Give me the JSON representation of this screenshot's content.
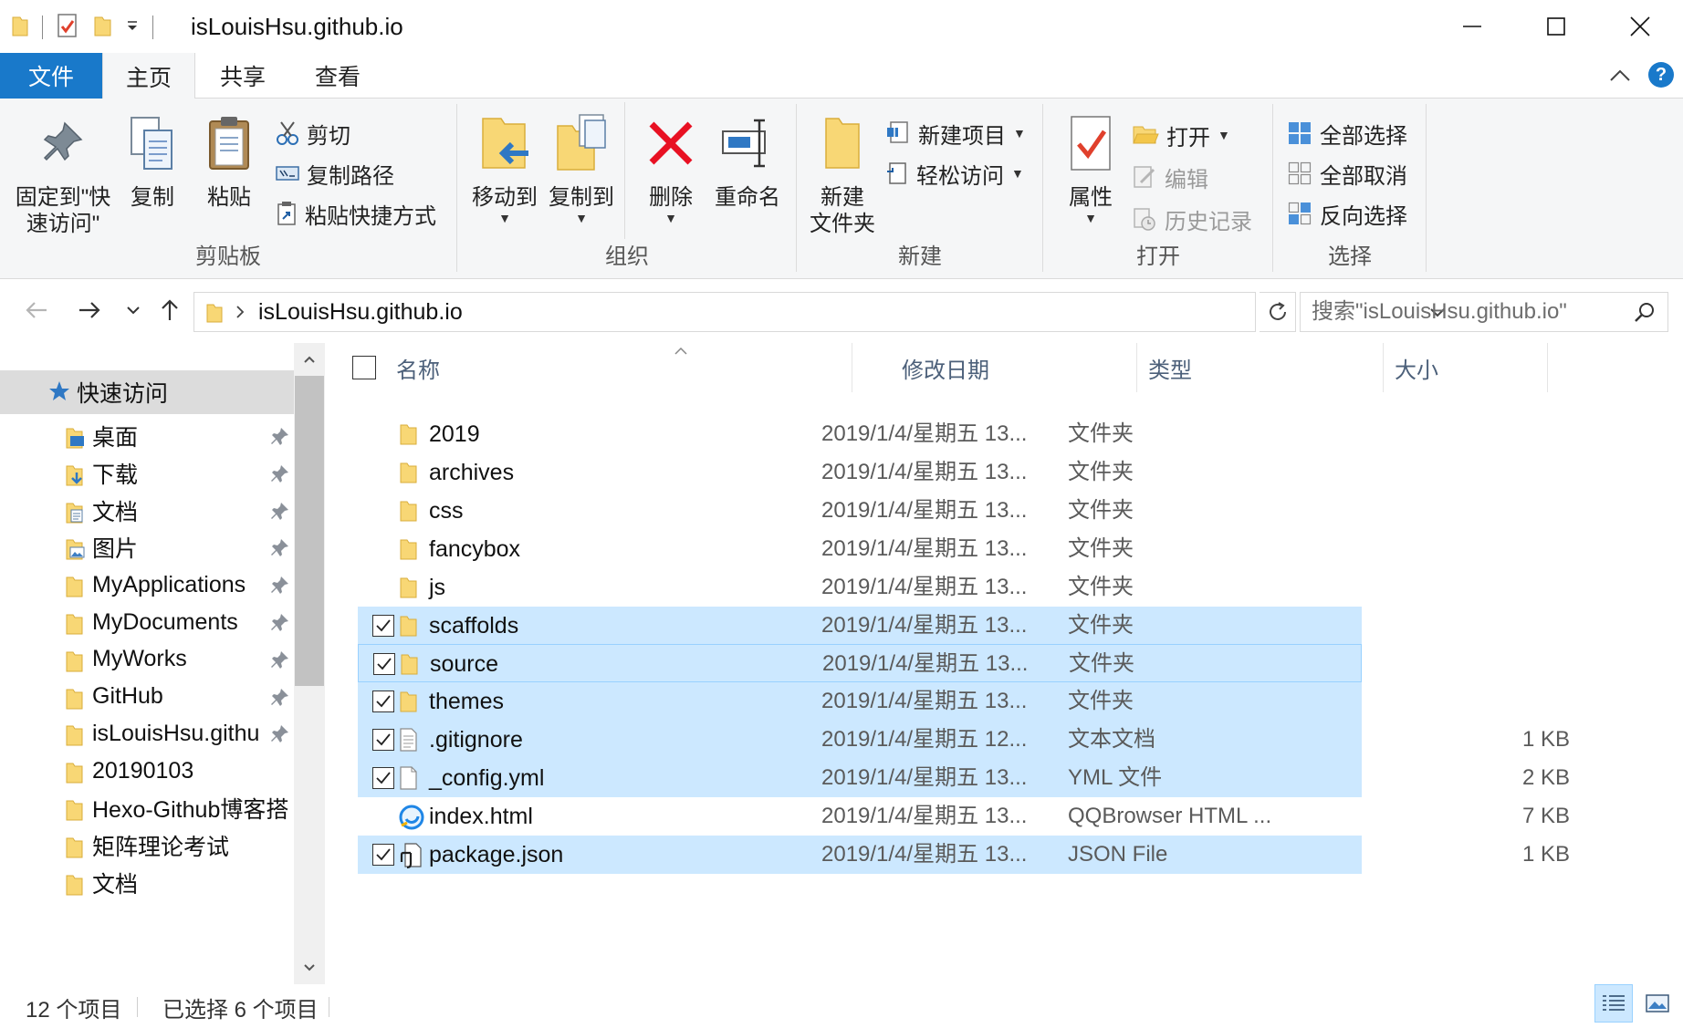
{
  "window": {
    "title": "isLouisHsu.github.io"
  },
  "ribbon_tabs": {
    "file": "文件",
    "home": "主页",
    "share": "共享",
    "view": "查看"
  },
  "help_label": "?",
  "clipboard": {
    "pin_quick_access": "固定到\"快\n速访问\"",
    "copy": "复制",
    "paste": "粘贴",
    "cut": "剪切",
    "copy_path": "复制路径",
    "paste_shortcut": "粘贴快捷方式",
    "group_label": "剪贴板"
  },
  "organize": {
    "move_to": "移动到",
    "copy_to": "复制到",
    "delete": "删除",
    "rename": "重命名",
    "group_label": "组织"
  },
  "new": {
    "new_folder": "新建\n文件夹",
    "new_item": "新建项目",
    "easy_access": "轻松访问",
    "group_label": "新建"
  },
  "open": {
    "properties": "属性",
    "open": "打开",
    "edit": "编辑",
    "history": "历史记录",
    "group_label": "打开"
  },
  "select": {
    "select_all": "全部选择",
    "select_none": "全部取消",
    "invert_selection": "反向选择",
    "group_label": "选择"
  },
  "address": {
    "path": "isLouisHsu.github.io",
    "search_placeholder": "搜索\"isLouisHsu.github.io\""
  },
  "nav_pane": {
    "quick_access": "快速访问",
    "items": [
      {
        "label": "桌面",
        "pinned": true,
        "icon": "desktop-folder-icon"
      },
      {
        "label": "下载",
        "pinned": true,
        "icon": "downloads-folder-icon"
      },
      {
        "label": "文档",
        "pinned": true,
        "icon": "documents-folder-icon"
      },
      {
        "label": "图片",
        "pinned": true,
        "icon": "pictures-folder-icon"
      },
      {
        "label": "MyApplications",
        "pinned": true,
        "icon": "folder-icon"
      },
      {
        "label": "MyDocuments",
        "pinned": true,
        "icon": "folder-icon"
      },
      {
        "label": "MyWorks",
        "pinned": true,
        "icon": "folder-icon"
      },
      {
        "label": "GitHub",
        "pinned": true,
        "icon": "folder-icon"
      },
      {
        "label": "isLouisHsu.githu",
        "pinned": true,
        "icon": "folder-icon"
      },
      {
        "label": "20190103",
        "pinned": false,
        "icon": "folder-icon"
      },
      {
        "label": "Hexo-Github博客搭",
        "pinned": false,
        "icon": "folder-icon"
      },
      {
        "label": "矩阵理论考试",
        "pinned": false,
        "icon": "folder-icon"
      },
      {
        "label": "文档",
        "pinned": false,
        "icon": "folder-icon"
      }
    ]
  },
  "columns": {
    "name": "名称",
    "date": "修改日期",
    "type": "类型",
    "size": "大小"
  },
  "files": [
    {
      "name": "2019",
      "date": "2019/1/4/星期五 13...",
      "type": "文件夹",
      "size": "",
      "icon": "folder-icon",
      "selected": false
    },
    {
      "name": "archives",
      "date": "2019/1/4/星期五 13...",
      "type": "文件夹",
      "size": "",
      "icon": "folder-icon",
      "selected": false
    },
    {
      "name": "css",
      "date": "2019/1/4/星期五 13...",
      "type": "文件夹",
      "size": "",
      "icon": "folder-icon",
      "selected": false
    },
    {
      "name": "fancybox",
      "date": "2019/1/4/星期五 13...",
      "type": "文件夹",
      "size": "",
      "icon": "folder-icon",
      "selected": false
    },
    {
      "name": "js",
      "date": "2019/1/4/星期五 13...",
      "type": "文件夹",
      "size": "",
      "icon": "folder-icon",
      "selected": false
    },
    {
      "name": "scaffolds",
      "date": "2019/1/4/星期五 13...",
      "type": "文件夹",
      "size": "",
      "icon": "folder-icon",
      "selected": true
    },
    {
      "name": "source",
      "date": "2019/1/4/星期五 13...",
      "type": "文件夹",
      "size": "",
      "icon": "folder-icon",
      "selected": true
    },
    {
      "name": "themes",
      "date": "2019/1/4/星期五 13...",
      "type": "文件夹",
      "size": "",
      "icon": "folder-icon",
      "selected": true
    },
    {
      "name": ".gitignore",
      "date": "2019/1/4/星期五 12...",
      "type": "文本文档",
      "size": "1 KB",
      "icon": "text-file-icon",
      "selected": true
    },
    {
      "name": "_config.yml",
      "date": "2019/1/4/星期五 13...",
      "type": "YML 文件",
      "size": "2 KB",
      "icon": "blank-file-icon",
      "selected": true
    },
    {
      "name": "index.html",
      "date": "2019/1/4/星期五 13...",
      "type": "QQBrowser HTML ...",
      "size": "7 KB",
      "icon": "browser-file-icon",
      "selected": false
    },
    {
      "name": "package.json",
      "date": "2019/1/4/星期五 13...",
      "type": "JSON File",
      "size": "1 KB",
      "icon": "json-file-icon",
      "selected": true
    }
  ],
  "status": {
    "item_count": "12 个项目",
    "selected_count": "已选择 6 个项目"
  },
  "colors": {
    "accent": "#1979ca",
    "selection": "#cce8ff",
    "selection_border": "#99d1ff",
    "folder": "#f8d775",
    "delete_red": "#e81123"
  }
}
